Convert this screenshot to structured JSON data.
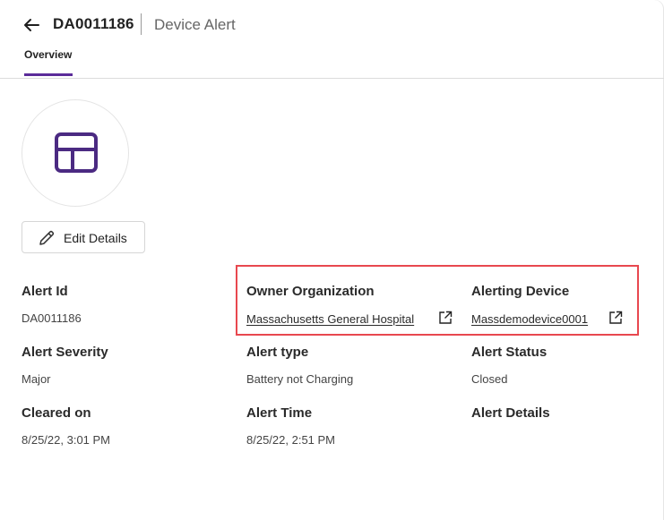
{
  "header": {
    "alert_id": "DA0011186",
    "record_type": "Device Alert"
  },
  "tabs": [
    {
      "label": "Overview",
      "active": true
    }
  ],
  "avatar": {
    "icon": "layout-icon",
    "color": "#4b2a82"
  },
  "edit_button": {
    "label": "Edit Details"
  },
  "fields": {
    "alert_id": {
      "label": "Alert Id",
      "value": "DA0011186"
    },
    "owner_organization": {
      "label": "Owner Organization",
      "value": "Massachusetts General Hospital"
    },
    "alerting_device": {
      "label": "Alerting Device",
      "value": "Massdemodevice0001"
    },
    "alert_severity": {
      "label": "Alert Severity",
      "value": "Major"
    },
    "alert_type": {
      "label": "Alert type",
      "value": "Battery not Charging"
    },
    "alert_status": {
      "label": "Alert Status",
      "value": "Closed"
    },
    "cleared_on": {
      "label": "Cleared on",
      "value": "8/25/22, 3:01 PM"
    },
    "alert_time": {
      "label": "Alert Time",
      "value": "8/25/22, 2:51 PM"
    },
    "alert_details": {
      "label": "Alert Details",
      "value": ""
    }
  },
  "colors": {
    "accent": "#5b2c99",
    "highlight": "#e8484f"
  }
}
